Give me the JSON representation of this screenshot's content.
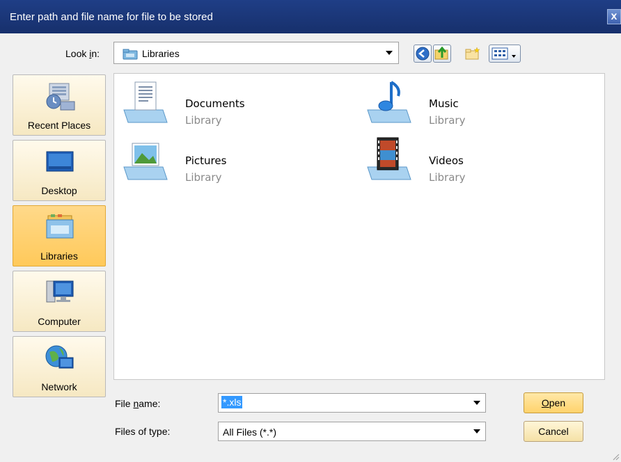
{
  "dialog": {
    "title": "Enter path and file name for file to be stored",
    "close_label": "x"
  },
  "lookin": {
    "label_pre": "Look ",
    "label_accel": "i",
    "label_post": "n:",
    "value": "Libraries"
  },
  "toolbar": {
    "buttons": [
      "back-icon",
      "up-folder-icon",
      "new-folder-icon",
      "view-menu-icon"
    ]
  },
  "places": [
    {
      "label": "Recent Places",
      "icon": "recent-places-icon",
      "selected": false
    },
    {
      "label": "Desktop",
      "icon": "desktop-icon",
      "selected": false
    },
    {
      "label": "Libraries",
      "icon": "libraries-icon",
      "selected": true
    },
    {
      "label": "Computer",
      "icon": "computer-icon",
      "selected": false
    },
    {
      "label": "Network",
      "icon": "network-icon",
      "selected": false
    }
  ],
  "files": [
    {
      "name": "Documents",
      "type": "Library",
      "icon": "documents-library-icon"
    },
    {
      "name": "Music",
      "type": "Library",
      "icon": "music-library-icon"
    },
    {
      "name": "Pictures",
      "type": "Library",
      "icon": "pictures-library-icon"
    },
    {
      "name": "Videos",
      "type": "Library",
      "icon": "videos-library-icon"
    }
  ],
  "filename": {
    "label_pre": "File ",
    "label_accel": "n",
    "label_post": "ame:",
    "value": "*.xls"
  },
  "filetype": {
    "label": "Files of type:",
    "value": "All Files (*.*)"
  },
  "buttons": {
    "open_accel": "O",
    "open_rest": "pen",
    "cancel": "Cancel"
  },
  "colors": {
    "titlebar": "#1f3e86",
    "selected_place": "#ffc95a",
    "selection": "#3399ff"
  }
}
